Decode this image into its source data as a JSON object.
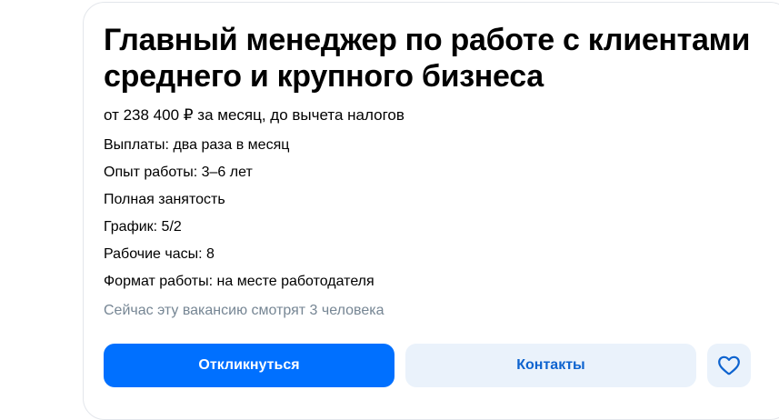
{
  "vacancy": {
    "title": "Главный менеджер по работе с клиентами среднего и крупного бизнеса",
    "salary": "от 238 400 ₽ за месяц, до вычета налогов",
    "details": [
      "Выплаты: два раза в месяц",
      "Опыт работы: 3–6 лет",
      "Полная занятость",
      "График: 5/2",
      "Рабочие часы: 8",
      "Формат работы: на месте работодателя"
    ],
    "viewers": "Сейчас эту вакансию смотрят 3 человека"
  },
  "actions": {
    "apply_label": "Откликнуться",
    "contacts_label": "Контакты",
    "favorite_icon": "heart-outline-icon"
  },
  "colors": {
    "primary": "#0070ff",
    "secondary_bg": "#eaf2fb",
    "secondary_text": "#0d63cf",
    "muted_text": "#768694",
    "border": "#e3e6eb"
  }
}
